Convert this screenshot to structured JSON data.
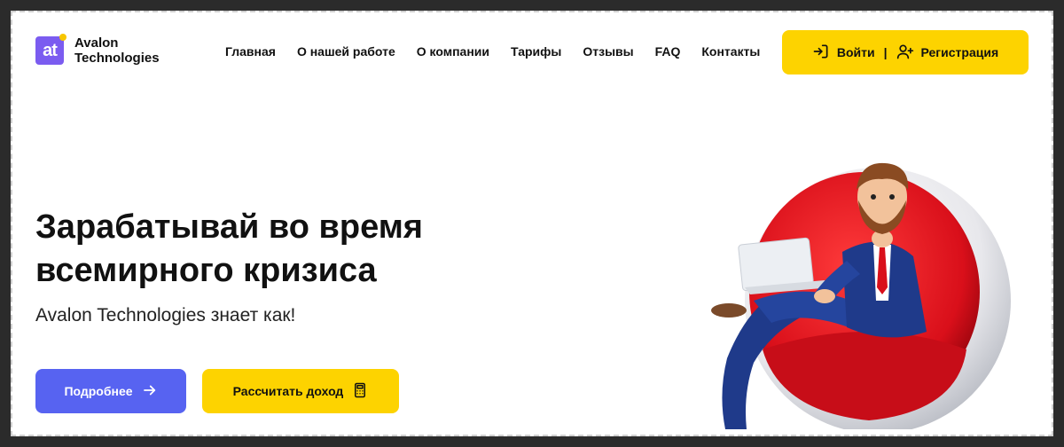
{
  "brand": {
    "logo_glyph": "at",
    "name_line1": "Avalon",
    "name_line2": "Technologies"
  },
  "nav": {
    "items": [
      {
        "label": "Главная"
      },
      {
        "label": "О нашей работе"
      },
      {
        "label": "О компании"
      },
      {
        "label": "Тарифы"
      },
      {
        "label": "Отзывы"
      },
      {
        "label": "FAQ"
      },
      {
        "label": "Контакты"
      }
    ]
  },
  "auth": {
    "login_label": "Войти",
    "separator": "|",
    "register_label": "Регистрация",
    "login_icon": "login-icon",
    "register_icon": "user-plus-icon"
  },
  "hero": {
    "title_line1": "Зарабатывай во время",
    "title_line2": "всемирного кризиса",
    "subtitle": "Avalon Technologies знает как!",
    "more_label": "Подробнее",
    "calc_label": "Рассчитать доход",
    "more_icon": "arrow-right-icon",
    "calc_icon": "calculator-icon"
  },
  "colors": {
    "accent_yellow": "#fdd300",
    "accent_blue": "#5763f1",
    "logo_purple": "#7b5cf0",
    "chair_red": "#e0141e"
  }
}
